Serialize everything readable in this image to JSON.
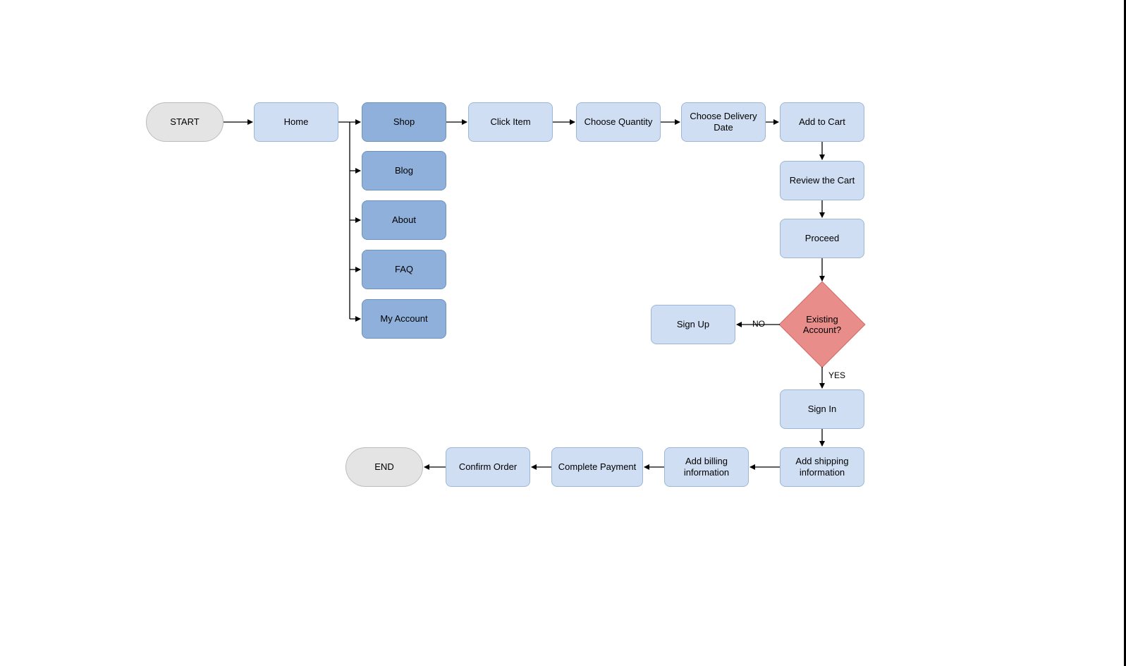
{
  "terminators": {
    "start": "START",
    "end": "END"
  },
  "nodes": {
    "home": "Home",
    "shop": "Shop",
    "blog": "Blog",
    "about": "About",
    "faq": "FAQ",
    "my_account": "My Account",
    "click_item": "Click Item",
    "choose_qty": "Choose Quantity",
    "choose_date": "Choose Delivery Date",
    "add_cart": "Add to Cart",
    "review_cart": "Review the Cart",
    "proceed": "Proceed",
    "sign_up": "Sign Up",
    "sign_in": "Sign In",
    "add_shipping": "Add shipping information",
    "add_billing": "Add billing information",
    "complete_payment": "Complete Payment",
    "confirm_order": "Confirm Order"
  },
  "decision": {
    "existing_account": "Existing Account?"
  },
  "edge_labels": {
    "no": "NO",
    "yes": "YES"
  }
}
